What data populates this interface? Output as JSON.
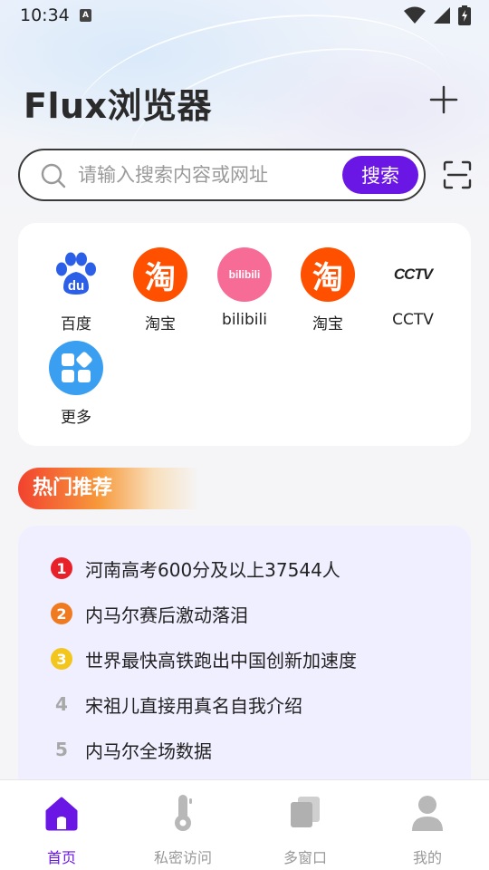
{
  "status_bar": {
    "time": "10:34",
    "a_badge": "A"
  },
  "header": {
    "title": "Flux浏览器"
  },
  "search": {
    "placeholder": "请输入搜索内容或网址",
    "button_label": "搜索"
  },
  "shortcuts": [
    {
      "label": "百度",
      "icon": "baidu-paw-icon",
      "glyph": "du"
    },
    {
      "label": "淘宝",
      "icon": "taobao-icon",
      "glyph": "淘"
    },
    {
      "label": "bilibili",
      "icon": "bilibili-icon",
      "glyph": "bilibili"
    },
    {
      "label": "淘宝",
      "icon": "taobao-icon",
      "glyph": "淘"
    },
    {
      "label": "CCTV",
      "icon": "cctv-icon",
      "glyph": "CCTV"
    },
    {
      "label": "更多",
      "icon": "more-apps-icon"
    }
  ],
  "hot": {
    "title": "热门推荐",
    "items": [
      {
        "rank": "1",
        "text": "河南高考600分及以上37544人"
      },
      {
        "rank": "2",
        "text": "内马尔赛后激动落泪"
      },
      {
        "rank": "3",
        "text": "世界最快高铁跑出中国创新加速度"
      },
      {
        "rank": "4",
        "text": "宋祖儿直接用真名自我介绍"
      },
      {
        "rank": "5",
        "text": "内马尔全场数据"
      }
    ]
  },
  "nav": [
    {
      "label": "首页",
      "icon": "home-icon",
      "active": true
    },
    {
      "label": "私密访问",
      "icon": "thermometer-key-icon",
      "active": false
    },
    {
      "label": "多窗口",
      "icon": "multi-window-icon",
      "active": false
    },
    {
      "label": "我的",
      "icon": "user-icon",
      "active": false
    }
  ],
  "colors": {
    "accent": "#6a17e6",
    "rank1": "#e8202a",
    "rank2": "#f07a1f",
    "rank3": "#f2c61c",
    "taobao": "#ff5000",
    "bilibili": "#f76c97",
    "baidu": "#2c5fe8",
    "more": "#3a9ff0"
  }
}
